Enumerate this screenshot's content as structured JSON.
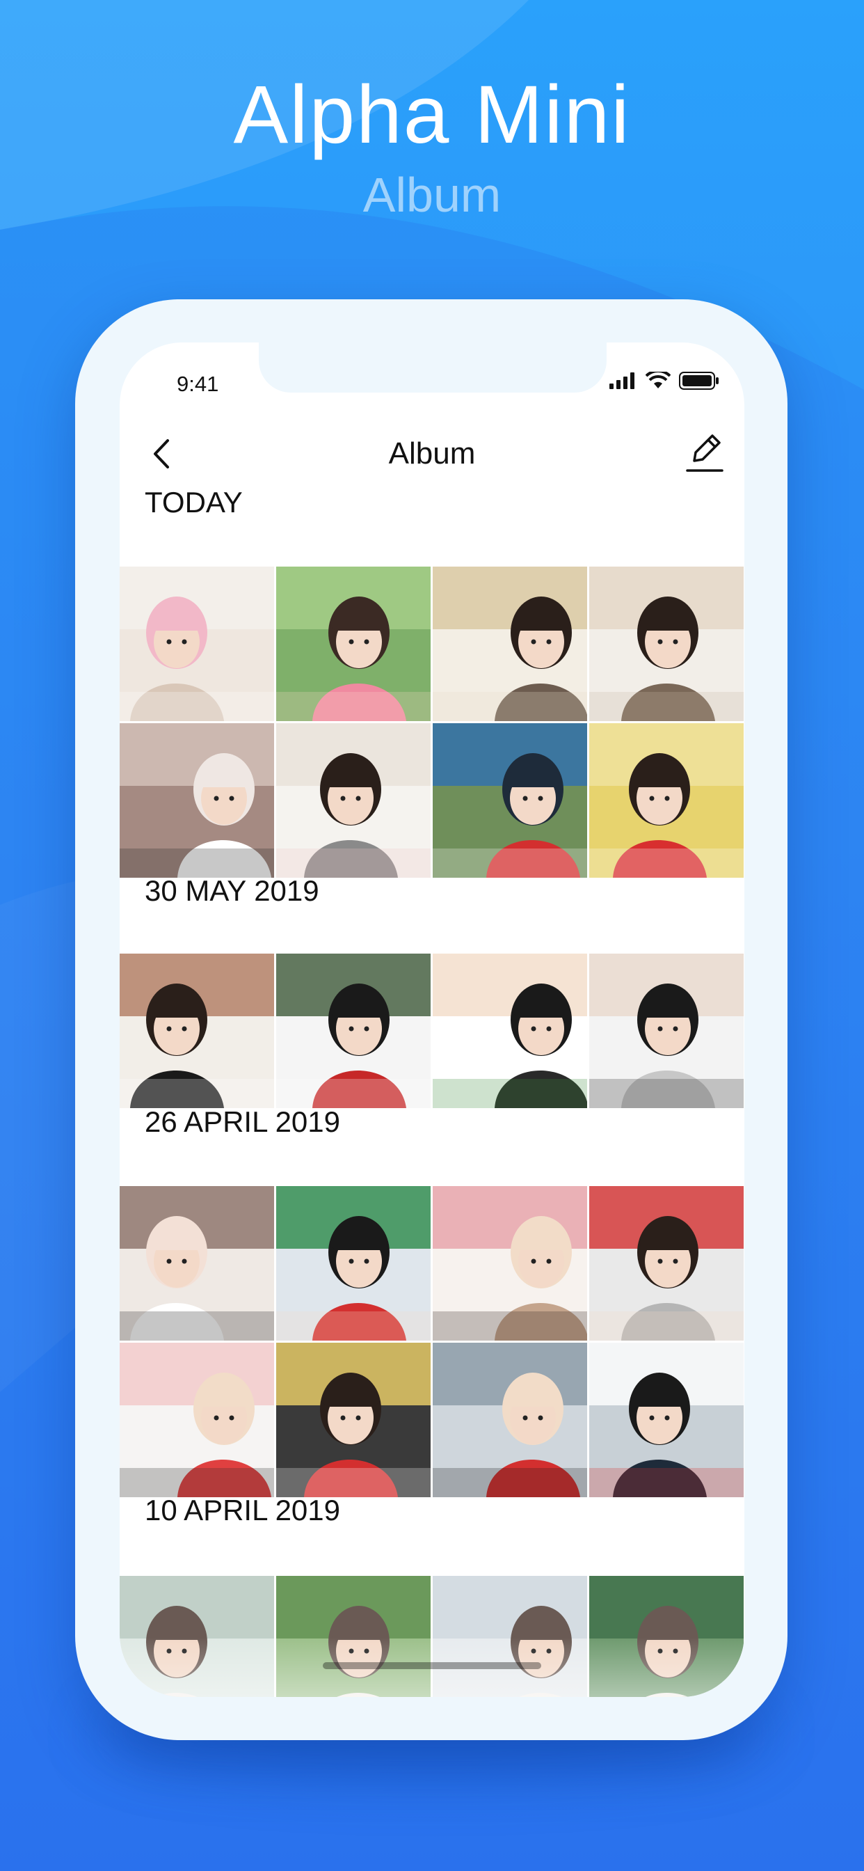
{
  "promo": {
    "title": "Alpha Mini",
    "subtitle": "Album"
  },
  "status_bar": {
    "time": "9:41",
    "icons": [
      "signal-icon",
      "wifi-icon",
      "battery-icon"
    ]
  },
  "nav": {
    "title": "Album",
    "back_icon": "chevron-left-icon",
    "edit_icon": "pencil-icon"
  },
  "sections": [
    {
      "title": "TODAY",
      "photo_count": 8
    },
    {
      "title": "30 MAY 2019",
      "photo_count": 4
    },
    {
      "title": "26 APRIL 2019",
      "photo_count": 8
    },
    {
      "title": "10 APRIL 2019",
      "photo_count": 4
    }
  ],
  "colors": {
    "background_top": "#2aa1fb",
    "background_bottom": "#2b72ee",
    "phone_frame": "#eef7fd",
    "text": "#111111"
  }
}
